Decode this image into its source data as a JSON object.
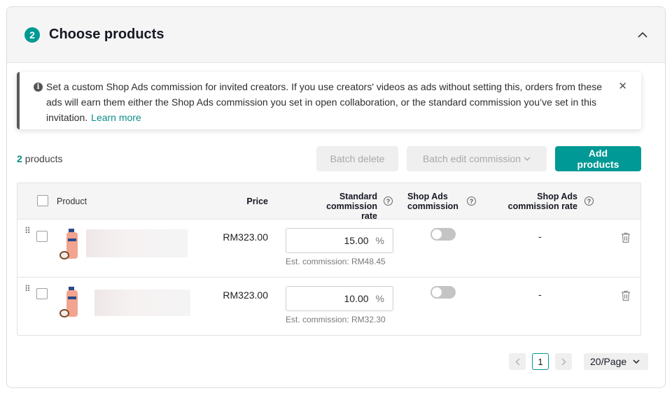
{
  "header": {
    "step": "2",
    "title": "Choose products"
  },
  "notice": {
    "text": "Set a custom Shop Ads commission for invited creators. If you use creators' videos as ads without setting this, orders from these ads will earn them either the Shop Ads commission you set in open collaboration, or the standard commission you’ve set in this invitation.",
    "link": "Learn more"
  },
  "toolbar": {
    "count": "2",
    "count_suffix": "products",
    "batch_delete": "Batch delete",
    "batch_edit": "Batch edit commission",
    "add_products": "Add products"
  },
  "table": {
    "headers": {
      "product": "Product",
      "price": "Price",
      "standard_rate_1": "Standard commission",
      "standard_rate_2": "rate",
      "shop_ads_1": "Shop Ads",
      "shop_ads_2": "commission",
      "shop_ads_rate_1": "Shop Ads",
      "shop_ads_rate_2": "commission rate"
    },
    "rows": [
      {
        "price": "RM323.00",
        "rate": "15.00",
        "unit": "%",
        "est": "Est. commission: RM48.45",
        "shop_ads_enabled": false,
        "shop_ads_rate": "-"
      },
      {
        "price": "RM323.00",
        "rate": "10.00",
        "unit": "%",
        "est": "Est. commission: RM32.30",
        "shop_ads_enabled": false,
        "shop_ads_rate": "-"
      }
    ]
  },
  "pagination": {
    "current": "1",
    "page_size": "20/Page"
  },
  "colors": {
    "accent": "#009995",
    "link": "#0a8f8a"
  },
  "icons": [
    "collapse-chevron-up-icon",
    "info-icon",
    "close-icon",
    "chevron-down-icon",
    "help-icon",
    "drag-handle-icon",
    "trash-icon",
    "chevron-left-icon",
    "chevron-right-icon"
  ]
}
